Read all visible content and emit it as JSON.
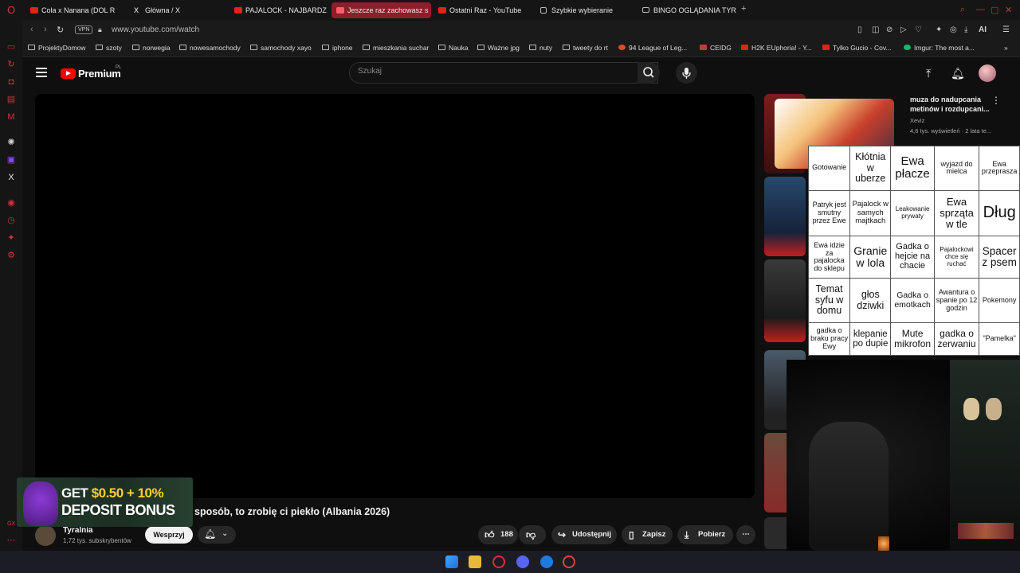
{
  "browser": {
    "tabs": [
      {
        "label": "Cola x Nanana (DOL R",
        "icon": "youtube-icon"
      },
      {
        "label": "Główna / X",
        "icon": "x-icon"
      },
      {
        "label": "PAJALOCK - NAJBARDZI",
        "icon": "youtube-icon"
      },
      {
        "label": "Jeszcze raz zachowasz s",
        "icon": "youtube-icon",
        "active": true
      },
      {
        "label": "Ostatni Raz - YouTube",
        "icon": "youtube-icon"
      },
      {
        "label": "Szybkie wybieranie",
        "icon": "speed-dial-icon"
      },
      {
        "label": "BINGO OGLĄDANIA TYRA",
        "icon": "bingo-icon"
      }
    ],
    "vpn_label": "VPN",
    "url": "www.youtube.com/watch",
    "ai_label": "AI",
    "bookmarks": [
      "ProjektyDomow",
      "szoty",
      "norwegia",
      "nowesamochody",
      "samochody xayo",
      "iphone",
      "mieszkania suchar",
      "Nauka",
      "Ważne jpg",
      "nuty",
      "tweety do rt",
      "94 League of Leg...",
      "CEIDG",
      "H2K EUphoria! - Y...",
      "Tylko Gucio - Cov...",
      "Imgur: The most a..."
    ]
  },
  "youtube": {
    "brand": "Premium",
    "region": "PL",
    "search_placeholder": "Szukaj",
    "video_title": "sposób, to zrobię ci piekło (Albania 2026)",
    "channel_name": "Tyralnia",
    "channel_subs": "1,72 tys. subskrybentów",
    "support_label": "Wesprzyj",
    "like_count": "188",
    "share_label": "Udostępnij",
    "save_label": "Zapisz",
    "download_label": "Pobierz"
  },
  "recommendation": {
    "title": "muza do nadupcania metinów i rozdupcani...",
    "channel": "Xeviz",
    "meta": "4,6 tys. wyświetleń · 2 lata te..."
  },
  "ad": {
    "line1_a": "GET ",
    "line1_b": "$0.50 + 10%",
    "line2": "DEPOSIT BONUS"
  },
  "bingo": [
    [
      "Gotowanie",
      "Kłótnia w uberze",
      "Ewa płacze",
      "wyjazd do mielca",
      "Ewa przeprasza"
    ],
    [
      "Patryk jest smutny przez Ewe",
      "Pajalock w samych majtkach",
      "Leakowanie prywaty",
      "Ewa sprząta w tle",
      "Dług"
    ],
    [
      "Ewa idzie za pajalocka do sklepu",
      "Granie w lola",
      "Gadka o hejcie na chacie",
      "Pajalockowi chce się ruchać",
      "Spacer z psem"
    ],
    [
      "Temat syfu w domu",
      "głos dziwki",
      "Gadka o emotkach",
      "Awantura o spanie po 12 godzin",
      "Pokemony"
    ],
    [
      "gadka o braku pracy Ewy",
      "klepanie po dupie",
      "Mute mikrofon",
      "gadka o zerwaniu",
      "\"Pamelka\""
    ]
  ],
  "colors": {
    "accent_red": "#ff0000",
    "active_tab": "#8f1d2a",
    "opera_red": "#d2323d"
  }
}
